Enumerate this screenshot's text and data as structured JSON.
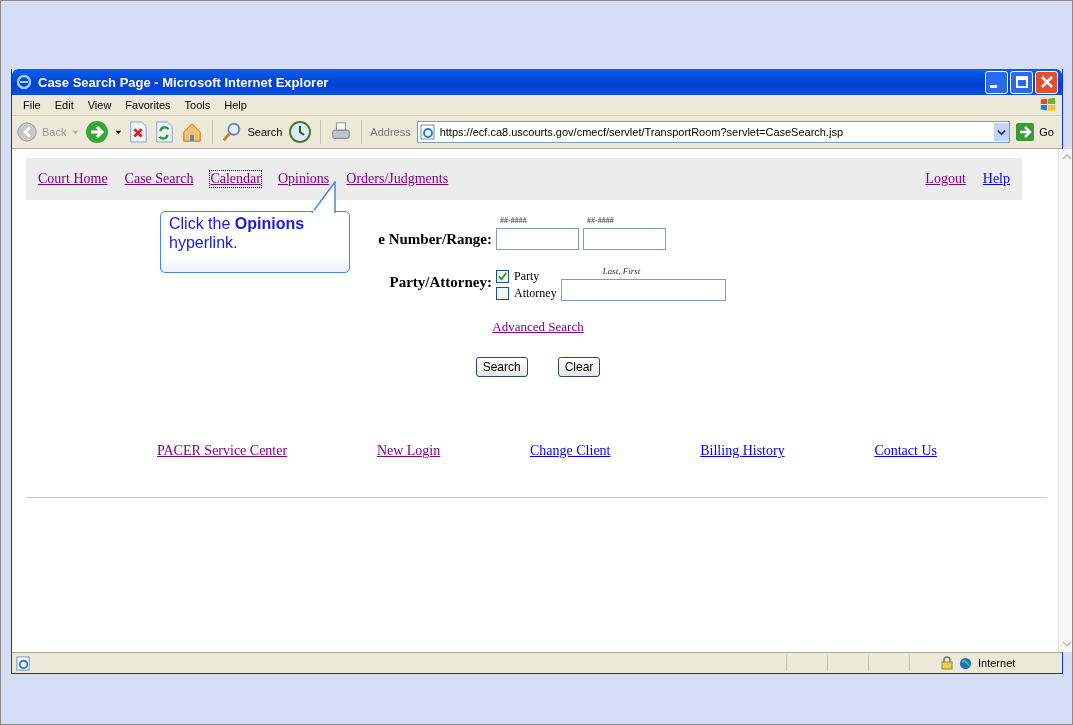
{
  "window": {
    "title": "Case Search Page - Microsoft Internet Explorer"
  },
  "menu": [
    "File",
    "Edit",
    "View",
    "Favorites",
    "Tools",
    "Help"
  ],
  "toolbar": {
    "back": "Back",
    "search": "Search",
    "address_label": "Address",
    "url": "https://ecf.ca8.uscourts.gov/cmecf/servlet/TransportRoom?servlet=CaseSearch.jsp",
    "go": "Go"
  },
  "nav": {
    "left": [
      {
        "label": "Court Home",
        "visited": true,
        "focused": false
      },
      {
        "label": "Case Search",
        "visited": true,
        "focused": false
      },
      {
        "label": "Calendar",
        "visited": true,
        "focused": true
      },
      {
        "label": "Opinions",
        "visited": true,
        "focused": false
      },
      {
        "label": "Orders/Judgments",
        "visited": true,
        "focused": false
      }
    ],
    "right": [
      {
        "label": "Logout",
        "visited": true,
        "focused": false
      },
      {
        "label": "Help",
        "visited": false,
        "focused": false
      }
    ]
  },
  "callout": {
    "text": "Click the **Opinions** hyperlink."
  },
  "form": {
    "case_label": "e Number/Range:",
    "case_hints": [
      "##-####",
      "##-####"
    ],
    "party_label": "Party/Attorney:",
    "options": [
      {
        "label": "Party",
        "checked": true
      },
      {
        "label": "Attorney",
        "checked": false
      }
    ],
    "name_hint": "Last, First",
    "advanced": "Advanced Search",
    "buttons": [
      "Search",
      "Clear"
    ]
  },
  "footer_links": [
    {
      "label": "PACER Service Center",
      "visited": true
    },
    {
      "label": "New Login",
      "visited": true
    },
    {
      "label": "Change Client",
      "visited": false
    },
    {
      "label": "Billing History",
      "visited": false
    },
    {
      "label": "Contact Us",
      "visited": false
    }
  ],
  "status_bar": {
    "zone": "Internet"
  }
}
